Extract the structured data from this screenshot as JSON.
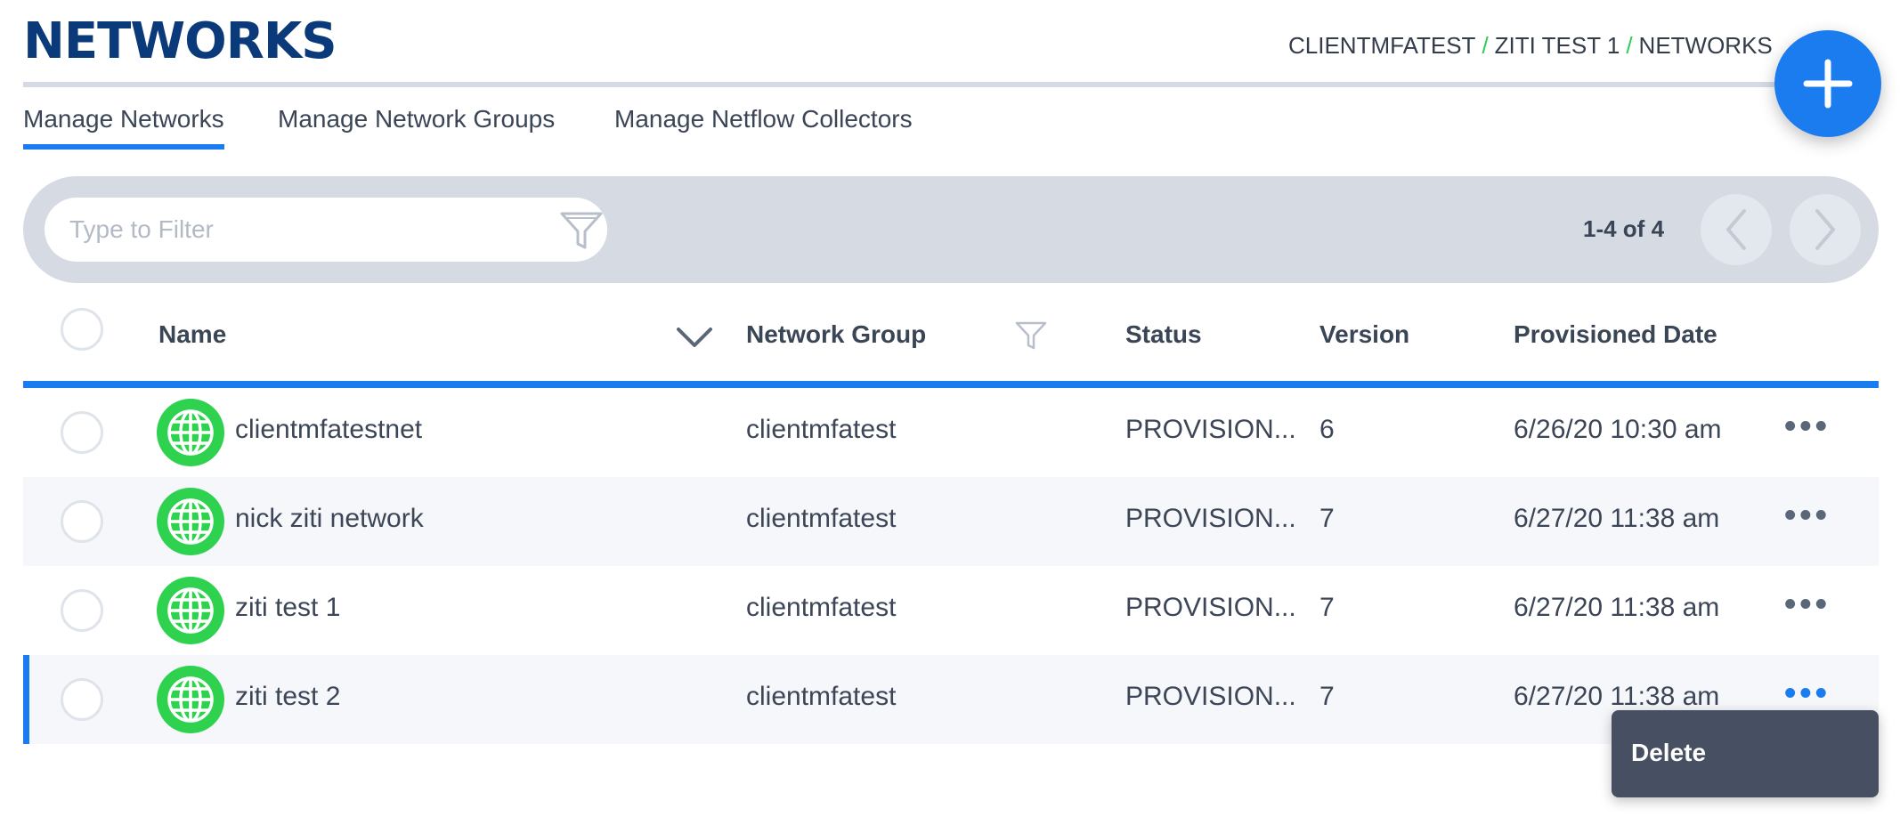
{
  "header": {
    "title": "NETWORKS",
    "breadcrumb": [
      "CLIENTMFATEST",
      "ZITI TEST 1",
      "NETWORKS"
    ],
    "breadcrumb_separator": "/"
  },
  "add_button": {
    "icon": "plus-icon"
  },
  "tabs": [
    {
      "label": "Manage Networks",
      "active": true
    },
    {
      "label": "Manage Network Groups",
      "active": false
    },
    {
      "label": "Manage Netflow Collectors",
      "active": false
    }
  ],
  "filter": {
    "placeholder": "Type to Filter",
    "value": "",
    "icon": "filter-icon"
  },
  "pagination": {
    "label": "1-4 of 4",
    "prev_icon": "chevron-left-icon",
    "next_icon": "chevron-right-icon"
  },
  "columns": {
    "name": "Name",
    "network_group": "Network Group",
    "status": "Status",
    "version": "Version",
    "provisioned_date": "Provisioned Date"
  },
  "rows": [
    {
      "name": "clientmfatestnet",
      "network_group": "clientmfatest",
      "status": "PROVISION...",
      "version": "6",
      "provisioned_date": "6/26/20 10:30 am",
      "icon": "globe-icon"
    },
    {
      "name": "nick ziti network",
      "network_group": "clientmfatest",
      "status": "PROVISION...",
      "version": "7",
      "provisioned_date": "6/27/20 11:38 am",
      "icon": "globe-icon"
    },
    {
      "name": "ziti test 1",
      "network_group": "clientmfatest",
      "status": "PROVISION...",
      "version": "7",
      "provisioned_date": "6/27/20 11:38 am",
      "icon": "globe-icon"
    },
    {
      "name": "ziti test 2",
      "network_group": "clientmfatest",
      "status": "PROVISION...",
      "version": "7",
      "provisioned_date": "6/27/20 11:38 am",
      "icon": "globe-icon"
    }
  ],
  "row_actions_label": "•••",
  "context_menu": {
    "items": [
      "Delete"
    ]
  },
  "colors": {
    "accent": "#1b7cf0",
    "title": "#0b3a7a",
    "status_green": "#2fd24f",
    "breadcrumb_separator": "#2ecc55"
  }
}
